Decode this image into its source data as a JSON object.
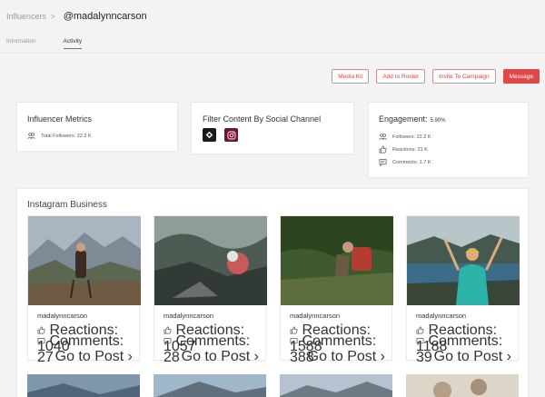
{
  "breadcrumb": {
    "parent": "Influencers",
    "separator": ">",
    "handle": "@madalynncarson"
  },
  "tabs": [
    {
      "label": "Information"
    },
    {
      "label": "Activity"
    }
  ],
  "actions": {
    "media_kit": "Media Kit",
    "add_roster": "Add to Roster",
    "invite": "Invite To Campaign",
    "message": "Message"
  },
  "metrics": {
    "title": "Influencer Metrics",
    "total_followers": "Total Followers: 22.2 K"
  },
  "filter": {
    "title": "Filter Content By Social Channel",
    "channels": [
      "tiktok-like-icon",
      "instagram-icon"
    ]
  },
  "engagement": {
    "title": "Engagement:",
    "rate": "5.90%",
    "followers": "Followers: 22.2 K",
    "reactions": "Reactions: 31 K",
    "comments": "Comments: 1.7 K"
  },
  "section_title": "Instagram Business",
  "posts": [
    {
      "user": "madalynncarson",
      "reactions": "Reactions: 1040",
      "comments": "Comments: 27",
      "goto": "Go to Post"
    },
    {
      "user": "madalynncarson",
      "reactions": "Reactions: 1057",
      "comments": "Comments: 28",
      "goto": "Go to Post"
    },
    {
      "user": "madalynncarson",
      "reactions": "Reactions: 1588",
      "comments": "Comments: 388",
      "goto": "Go to Post"
    },
    {
      "user": "madalynncarson",
      "reactions": "Reactions: 1188",
      "comments": "Comments: 39",
      "goto": "Go to Post"
    }
  ],
  "colors": {
    "accent": "#e04848",
    "background": "#f3f3f3"
  }
}
